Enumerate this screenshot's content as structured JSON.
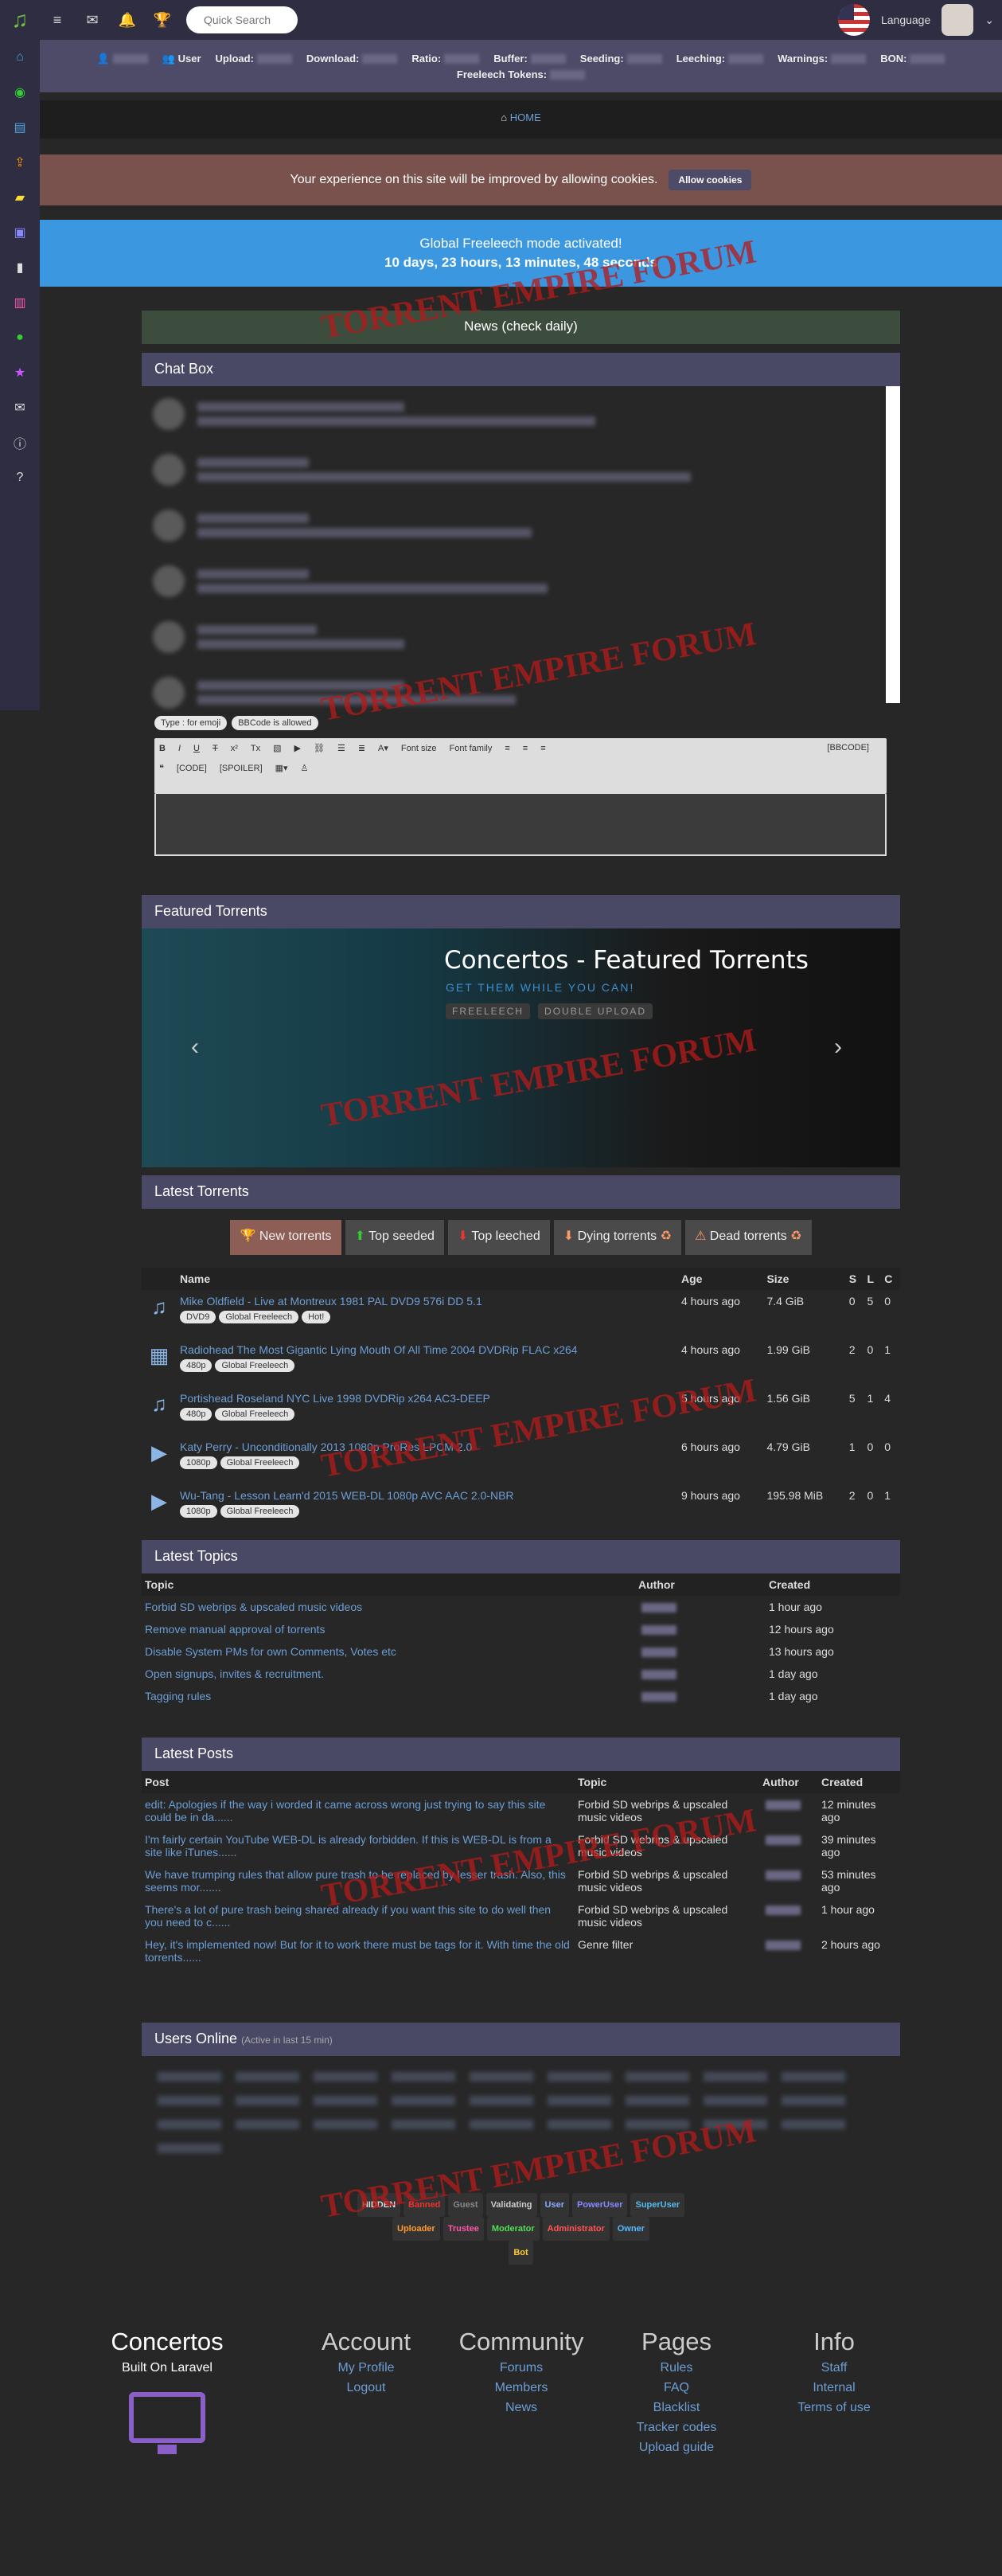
{
  "search": {
    "placeholder": "Quick Search"
  },
  "lang": "Language",
  "stats": {
    "user": "User",
    "upload": "Upload:",
    "download": "Download:",
    "ratio": "Ratio:",
    "buffer": "Buffer:",
    "seeding": "Seeding:",
    "leeching": "Leeching:",
    "warnings": "Warnings:",
    "bon": "BON:",
    "tokens": "Freeleech Tokens:"
  },
  "crumb": "HOME",
  "cookie": {
    "text": "Your experience on this site will be improved by allowing cookies.",
    "button": "Allow cookies"
  },
  "freeleech": {
    "title": "Global Freeleech mode activated!",
    "timer": "10 days, 23 hours, 13 minutes, 48 seconds"
  },
  "news": "News (check daily)",
  "chat": {
    "title": "Chat Box",
    "emoji": "Type : for emoji",
    "bbcode_allowed": "BBCode is allowed",
    "font_size": "Font size",
    "font_family": "Font family",
    "bbcode": "[BBCODE]",
    "code": "[CODE]",
    "spoiler": "[SPOILER]"
  },
  "featured": {
    "title": "Featured Torrents",
    "slide_title": "Concertos - Featured Torrents",
    "slide_sub": "GET THEM WHILE YOU CAN!",
    "tag1": "FREELEECH",
    "tag2": "DOUBLE UPLOAD"
  },
  "latest": {
    "title": "Latest Torrents",
    "tabs": [
      "New torrents",
      "Top seeded",
      "Top leeched",
      "Dying torrents",
      "Dead torrents"
    ],
    "headers": [
      "Name",
      "Age",
      "Size",
      "S",
      "L",
      "C"
    ],
    "rows": [
      {
        "name": "Mike Oldfield - Live at Montreux 1981 PAL DVD9 576i DD 5.1",
        "badges": [
          "DVD9",
          "Global Freeleech",
          "Hot!"
        ],
        "age": "4 hours ago",
        "size": "7.4 GiB",
        "s": "0",
        "l": "5",
        "c": "0",
        "icon": "music-icon"
      },
      {
        "name": "Radiohead The Most Gigantic Lying Mouth Of All Time 2004 DVDRip FLAC x264",
        "badges": [
          "480p",
          "Global Freeleech"
        ],
        "age": "4 hours ago",
        "size": "1.99 GiB",
        "s": "2",
        "l": "0",
        "c": "1",
        "icon": "film-icon"
      },
      {
        "name": "Portishead Roseland NYC Live 1998 DVDRip x264 AC3-DEEP",
        "badges": [
          "480p",
          "Global Freeleech"
        ],
        "age": "5 hours ago",
        "size": "1.56 GiB",
        "s": "5",
        "l": "1",
        "c": "4",
        "icon": "music-icon"
      },
      {
        "name": "Katy Perry - Unconditionally 2013 1080p ProRes LPCM 2.0",
        "badges": [
          "1080p",
          "Global Freeleech"
        ],
        "age": "6 hours ago",
        "size": "4.79 GiB",
        "s": "1",
        "l": "0",
        "c": "0",
        "icon": "play-icon"
      },
      {
        "name": "Wu-Tang - Lesson Learn'd 2015 WEB-DL 1080p AVC AAC 2.0-NBR",
        "badges": [
          "1080p",
          "Global Freeleech"
        ],
        "age": "9 hours ago",
        "size": "195.98 MiB",
        "s": "2",
        "l": "0",
        "c": "1",
        "icon": "play-icon"
      }
    ]
  },
  "topics": {
    "title": "Latest Topics",
    "headers": [
      "Topic",
      "Author",
      "Created"
    ],
    "rows": [
      {
        "t": "Forbid SD webrips & upscaled music videos",
        "c": "1 hour ago"
      },
      {
        "t": "Remove manual approval of torrents",
        "c": "12 hours ago"
      },
      {
        "t": "Disable System PMs for own Comments, Votes etc",
        "c": "13 hours ago"
      },
      {
        "t": "Open signups, invites & recruitment.",
        "c": "1 day ago"
      },
      {
        "t": "Tagging rules",
        "c": "1 day ago"
      }
    ]
  },
  "posts": {
    "title": "Latest Posts",
    "headers": [
      "Post",
      "Topic",
      "Author",
      "Created"
    ],
    "rows": [
      {
        "p": "edit: Apologies if the way i worded it came across wrong just trying to say this site could be in da......",
        "t": "Forbid SD webrips & upscaled music videos",
        "c": "12 minutes ago"
      },
      {
        "p": "I'm fairly certain YouTube WEB-DL is already forbidden.  If this is WEB-DL is from a site like iTunes......",
        "t": "Forbid SD webrips & upscaled music videos",
        "c": "39 minutes ago"
      },
      {
        "p": "We have trumping rules that allow pure trash to be replaced by lesser trash. Also, this seems mor.......",
        "t": "Forbid SD webrips & upscaled music videos",
        "c": "53 minutes ago"
      },
      {
        "p": "There's a lot of pure trash being shared already if you want this site to do well then you need to c......",
        "t": "Forbid SD webrips & upscaled music videos",
        "c": "1 hour ago"
      },
      {
        "p": "Hey, it's implemented now! But for it to work there must be tags for it. With time the old torrents......",
        "t": "Genre filter",
        "c": "2 hours ago"
      }
    ]
  },
  "online": {
    "title": "Users Online",
    "sub": "(Active in last 15 min)",
    "groups": [
      "HIDDEN",
      "Banned",
      "Guest",
      "Validating",
      "User",
      "PowerUser",
      "SuperUser",
      "Uploader",
      "Trustee",
      "Moderator",
      "Administrator",
      "Owner",
      "Bot"
    ]
  },
  "footer": {
    "brand": "Concertos",
    "tagline": "Built On Laravel",
    "account": {
      "title": "Account",
      "links": [
        "My Profile",
        "Logout"
      ]
    },
    "community": {
      "title": "Community",
      "links": [
        "Forums",
        "Members",
        "News"
      ]
    },
    "pages": {
      "title": "Pages",
      "links": [
        "Rules",
        "FAQ",
        "Blacklist",
        "Tracker codes",
        "Upload guide"
      ]
    },
    "info": {
      "title": "Info",
      "links": [
        "Staff",
        "Internal",
        "Terms of use"
      ]
    }
  },
  "watermark": "TORRENT EMPIRE FORUM",
  "colors": {
    "accent": "#4e4b68",
    "freeleech": "#3b98e0",
    "cookie": "#7a524d"
  }
}
